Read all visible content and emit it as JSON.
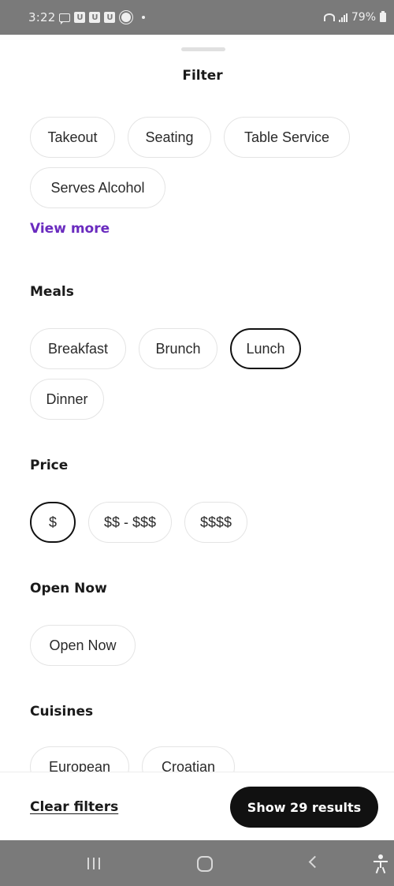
{
  "status_bar": {
    "time": "3:22",
    "notification_badges": [
      "U",
      "U",
      "U"
    ],
    "battery": "79%"
  },
  "sheet": {
    "title": "Filter"
  },
  "service_options": {
    "chips": [
      {
        "label": "Takeout",
        "selected": false
      },
      {
        "label": "Seating",
        "selected": false
      },
      {
        "label": "Table Service",
        "selected": false
      },
      {
        "label": "Serves Alcohol",
        "selected": false
      }
    ],
    "view_more": "View more"
  },
  "meals": {
    "title": "Meals",
    "chips": [
      {
        "label": "Breakfast",
        "selected": false
      },
      {
        "label": "Brunch",
        "selected": false
      },
      {
        "label": "Lunch",
        "selected": true
      },
      {
        "label": "Dinner",
        "selected": false
      }
    ]
  },
  "price": {
    "title": "Price",
    "chips": [
      {
        "label": "$",
        "selected": true
      },
      {
        "label": "$$ - $$$",
        "selected": false
      },
      {
        "label": "$$$$",
        "selected": false
      }
    ]
  },
  "open_now": {
    "title": "Open Now",
    "chips": [
      {
        "label": "Open Now",
        "selected": false
      }
    ]
  },
  "cuisines": {
    "title": "Cuisines",
    "chips": [
      {
        "label": "European",
        "selected": false
      },
      {
        "label": "Croatian",
        "selected": false
      }
    ]
  },
  "actions": {
    "clear_label": "Clear filters",
    "show_results_label": "Show 29 results"
  },
  "colors": {
    "accent_link": "#6a2bbf",
    "primary_button": "#111111",
    "chip_border": "#e4e4e4",
    "system_bars": "#7a7a7a"
  },
  "nav_bar": {
    "icons": [
      "recents-icon",
      "home-icon",
      "back-icon",
      "accessibility-icon"
    ]
  }
}
